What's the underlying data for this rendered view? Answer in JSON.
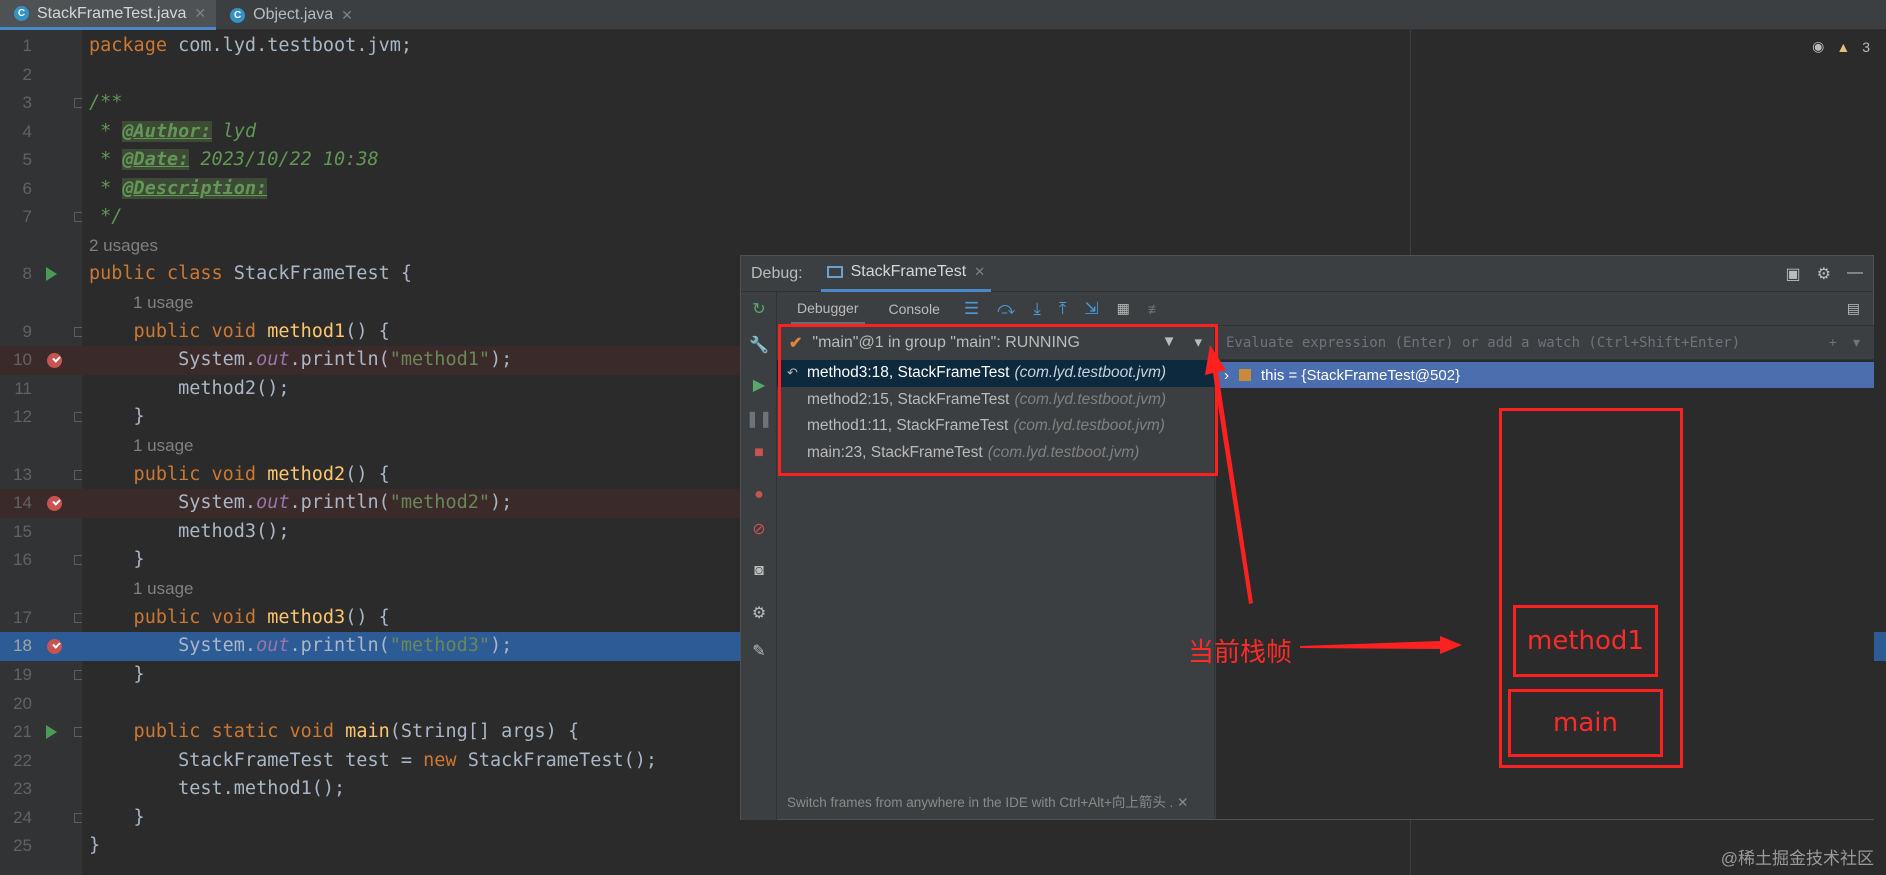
{
  "tabs": [
    {
      "label": "StackFrameTest.java",
      "active": true
    },
    {
      "label": "Object.java",
      "active": false
    }
  ],
  "editor": {
    "lines": [
      {
        "n": "1",
        "type": "code",
        "html_key": "l1"
      },
      {
        "n": "2"
      },
      {
        "n": "3"
      },
      {
        "n": "4"
      },
      {
        "n": "5"
      },
      {
        "n": "6"
      },
      {
        "n": "7"
      }
    ],
    "usages_2": "2 usages",
    "usage_1": "1 usage",
    "code": {
      "l1_kw": "package",
      "l1_rest": " com.lyd.testboot.jvm;",
      "l3": "/**",
      "l4_star": " * ",
      "l4_tag": "@Author:",
      "l4_val": " lyd",
      "l5_tag": "@Date:",
      "l5_val": " 2023/10/22 10:38",
      "l6_tag": "@Description:",
      "l7": " */",
      "l8_kw": "public class",
      "l8_name": " StackFrameTest {",
      "l9_kw": "    public void",
      "l9_fn": " method1",
      "l9_rest": "() {",
      "l10_a": "        System.",
      "l10_f": "out",
      "l10_b": ".println(",
      "l10_s": "\"method1\"",
      "l10_c": ");",
      "l11": "        method2();",
      "l12": "    }",
      "l13_fn": " method2",
      "l14_s": "\"method2\"",
      "l15": "        method3();",
      "l17_fn": " method3",
      "l18_s": "\"method3\"",
      "l21_kw": "    public static void",
      "l21_fn": " main",
      "l21_rest": "(String[] args) {",
      "l22_a": "        StackFrameTest test = ",
      "l22_kw": "new",
      "l22_b": " StackFrameTest();",
      "l23": "        test.method1();",
      "l24": "    }",
      "l25": "}"
    },
    "inspection_count": "3"
  },
  "debug": {
    "title": "Debug:",
    "session": "StackFrameTest",
    "subtabs": [
      "Debugger",
      "Console"
    ],
    "thread": "\"main\"@1 in group \"main\": RUNNING",
    "frames": [
      {
        "method": "method3:18, StackFrameTest",
        "pkg": "(com.lyd.testboot.jvm)",
        "selected": true
      },
      {
        "method": "method2:15, StackFrameTest",
        "pkg": "(com.lyd.testboot.jvm)",
        "selected": false
      },
      {
        "method": "method1:11, StackFrameTest",
        "pkg": "(com.lyd.testboot.jvm)",
        "selected": false
      },
      {
        "method": "main:23, StackFrameTest",
        "pkg": "(com.lyd.testboot.jvm)",
        "selected": false
      }
    ],
    "hint": "Switch frames from anywhere in the IDE with Ctrl+Alt+向上箭头 .",
    "eval_placeholder": "Evaluate expression (Enter) or add a watch (Ctrl+Shift+Enter)",
    "variable": "this = {StackFrameTest@502}"
  },
  "annotations": {
    "current_frame": "当前栈帧",
    "stack_top": "method1",
    "stack_bottom": "main"
  },
  "watermark": "@稀土掘金技术社区",
  "colors": {
    "accent": "#4a88c7",
    "annotation": "#ff2020",
    "breakpoint": "#c75450"
  }
}
